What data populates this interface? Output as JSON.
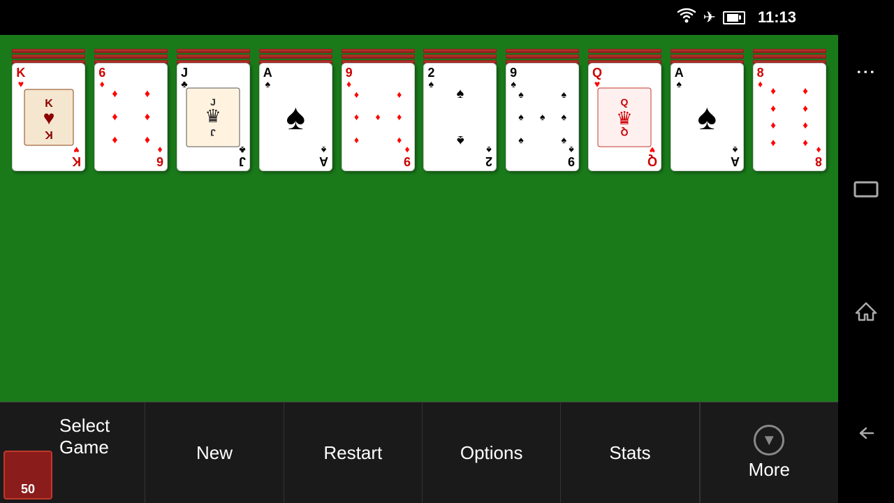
{
  "statusBar": {
    "time": "11:13"
  },
  "columns": [
    {
      "id": "col1",
      "rank": "K",
      "suit": "♥",
      "color": "red",
      "type": "king",
      "stackLines": 4
    },
    {
      "id": "col2",
      "rank": "6",
      "suit": "♦",
      "color": "red",
      "type": "six",
      "stackLines": 4
    },
    {
      "id": "col3",
      "rank": "J",
      "suit": "♣",
      "color": "black",
      "type": "jack",
      "stackLines": 4
    },
    {
      "id": "col4",
      "rank": "A",
      "suit": "♠",
      "color": "black",
      "type": "ace",
      "stackLines": 4
    },
    {
      "id": "col5",
      "rank": "9",
      "suit": "♦",
      "color": "red",
      "type": "nine",
      "stackLines": 4
    },
    {
      "id": "col6",
      "rank": "2",
      "suit": "♠",
      "color": "black",
      "type": "two",
      "stackLines": 4
    },
    {
      "id": "col7",
      "rank": "9",
      "suit": "♠",
      "color": "black",
      "type": "nine-spade",
      "stackLines": 4
    },
    {
      "id": "col8",
      "rank": "Q",
      "suit": "♥",
      "color": "red",
      "type": "queen",
      "stackLines": 4
    },
    {
      "id": "col9",
      "rank": "A",
      "suit": "♠",
      "color": "black",
      "type": "ace2",
      "stackLines": 4
    },
    {
      "id": "col10",
      "rank": "8",
      "suit": "♦",
      "color": "red",
      "type": "eight",
      "stackLines": 4
    }
  ],
  "bottomBar": {
    "selectGame": "Select Game",
    "gameNumber": "50",
    "new": "New",
    "restart": "Restart",
    "options": "Options",
    "stats": "Stats",
    "more": "More"
  }
}
